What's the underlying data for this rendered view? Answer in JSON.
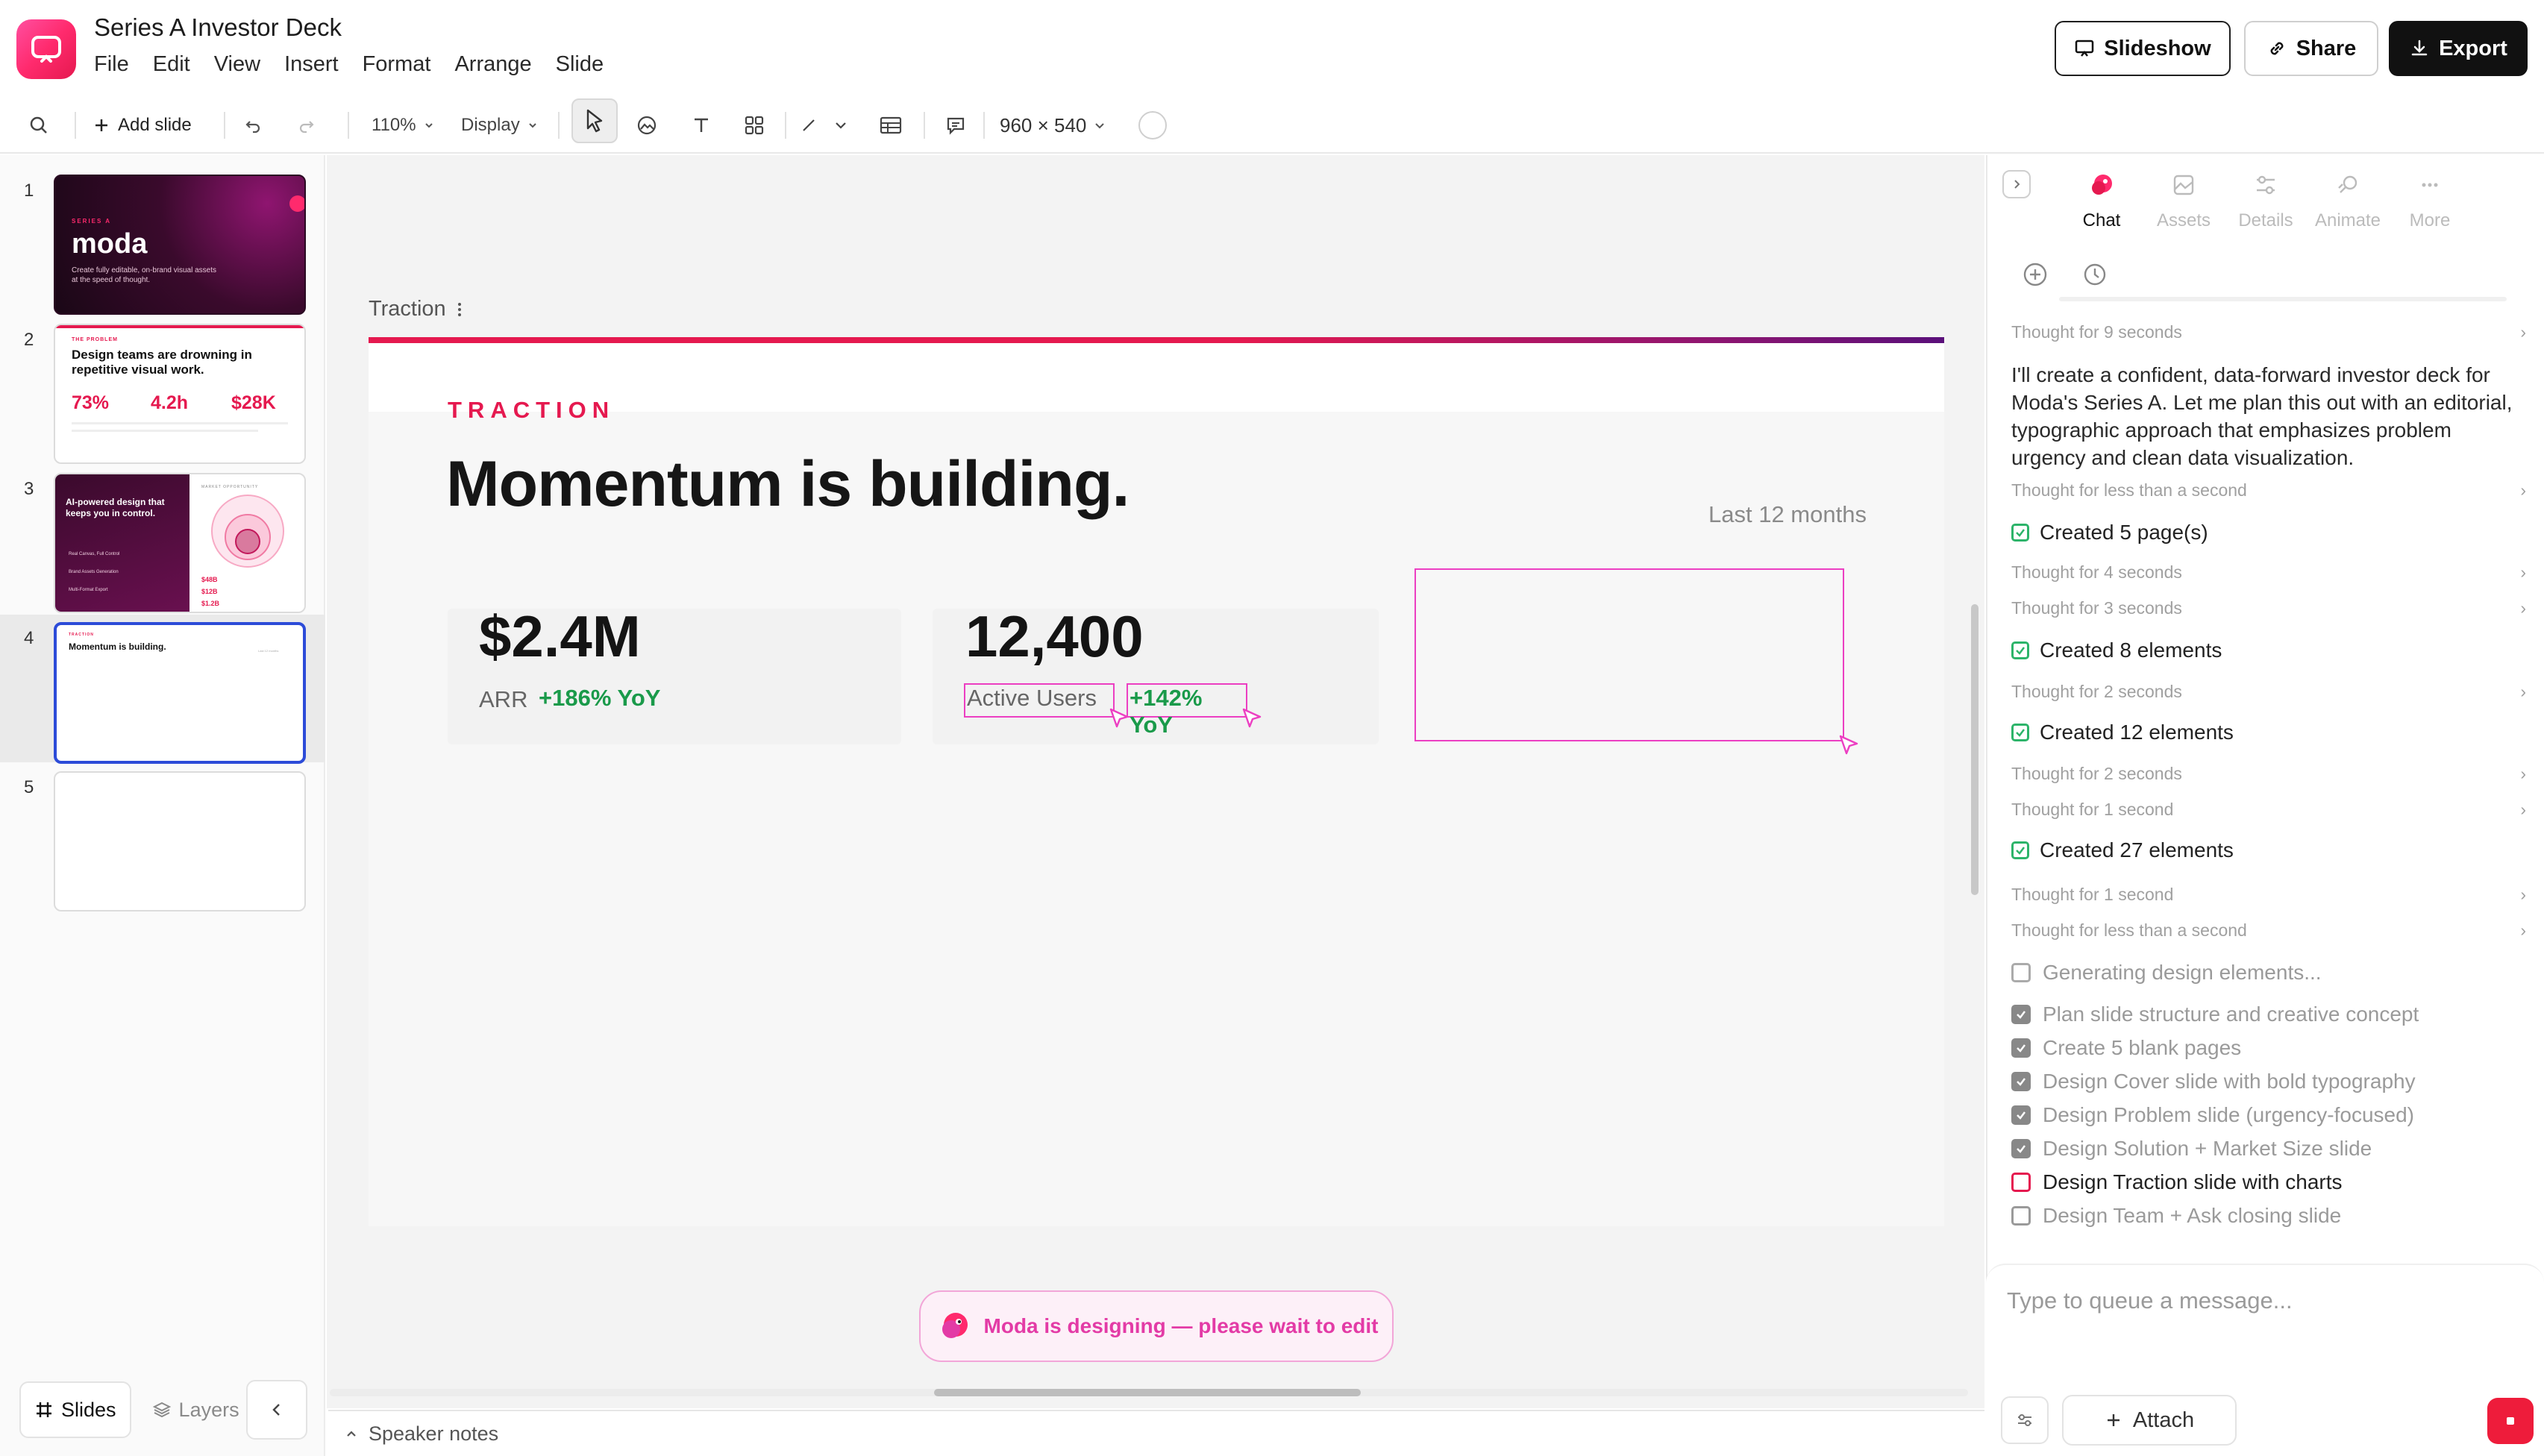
{
  "app": {
    "title": "Series A Investor Deck",
    "menu": [
      "File",
      "Edit",
      "View",
      "Insert",
      "Format",
      "Arrange",
      "Slide"
    ],
    "actions": {
      "slideshow": "Slideshow",
      "share": "Share",
      "export": "Export"
    },
    "brand_color": "#ff2a6d"
  },
  "toolbar": {
    "add_slide": "Add slide",
    "zoom": "110%",
    "display": "Display",
    "canvas_size": "960 × 540"
  },
  "sidebar": {
    "slides": [
      {
        "number": "1",
        "kind": "cover",
        "eyebrow": "SERIES A",
        "title": "moda",
        "text": "Create fully editable, on-brand visual assets at the speed of thought."
      },
      {
        "number": "2",
        "kind": "problem",
        "eyebrow": "THE PROBLEM",
        "title": "Design teams are drowning in repetitive visual work.",
        "stats": [
          "73%",
          "4.2h",
          "$28K"
        ]
      },
      {
        "number": "3",
        "kind": "solution",
        "title": "AI-powered design that keeps you in control.",
        "market_label": "MARKET OPPORTUNITY",
        "stats": [
          "$48B",
          "$12B",
          "$1.2B"
        ],
        "features": [
          "Real Canvas, Full Control",
          "Brand Assets Generation",
          "Multi-Format Export"
        ]
      },
      {
        "number": "4",
        "kind": "traction",
        "eyebrow": "TRACTION",
        "title": "Momentum is building.",
        "text": "Last 12 months"
      },
      {
        "number": "5",
        "kind": "blank"
      }
    ],
    "tabs": {
      "slides": "Slides",
      "layers": "Layers"
    }
  },
  "slide": {
    "label": "Traction",
    "eyebrow": "TRACTION",
    "title": "Momentum is building.",
    "period": "Last 12 months",
    "kpis": [
      {
        "value": "$2.4M",
        "label": "ARR",
        "growth": "+186% YoY"
      },
      {
        "value": "12,400",
        "label": "Active Users",
        "growth": "+142% YoY"
      }
    ],
    "accent_color": "#e5194f",
    "growth_color": "#1a9a4a"
  },
  "status": {
    "designing": "Moda is designing — please wait to edit"
  },
  "notes": {
    "label": "Speaker notes"
  },
  "panel": {
    "tabs": [
      "Chat",
      "Assets",
      "Details",
      "Animate",
      "More"
    ],
    "active_tab": "Chat",
    "log": {
      "t1": "Thought for 9 seconds",
      "message": "I'll create a confident, data-forward investor deck for Moda's Series A. Let me plan this out with an editorial, typographic approach that emphasizes problem urgency and clean data visualization.",
      "t2": "Thought for less than a second",
      "c1": "Created 5 page(s)",
      "t3": "Thought for 4 seconds",
      "t4": "Thought for 3 seconds",
      "c2": "Created 8 elements",
      "t5": "Thought for 2 seconds",
      "c3": "Created 12 elements",
      "t6": "Thought for 2 seconds",
      "t7": "Thought for 1 second",
      "c4": "Created 27 elements",
      "t8": "Thought for 1 second",
      "t9": "Thought for less than a second",
      "generating": "Generating design elements..."
    },
    "todos": [
      {
        "text": "Plan slide structure and creative concept",
        "state": "done"
      },
      {
        "text": "Create 5 blank pages",
        "state": "done"
      },
      {
        "text": "Design Cover slide with bold typography",
        "state": "done"
      },
      {
        "text": "Design Problem slide (urgency-focused)",
        "state": "done"
      },
      {
        "text": "Design Solution + Market Size slide",
        "state": "done"
      },
      {
        "text": "Design Traction slide with charts",
        "state": "current"
      },
      {
        "text": "Design Team + Ask closing slide",
        "state": "pending"
      }
    ],
    "composer": {
      "placeholder": "Type to queue a message...",
      "attach": "Attach"
    }
  }
}
